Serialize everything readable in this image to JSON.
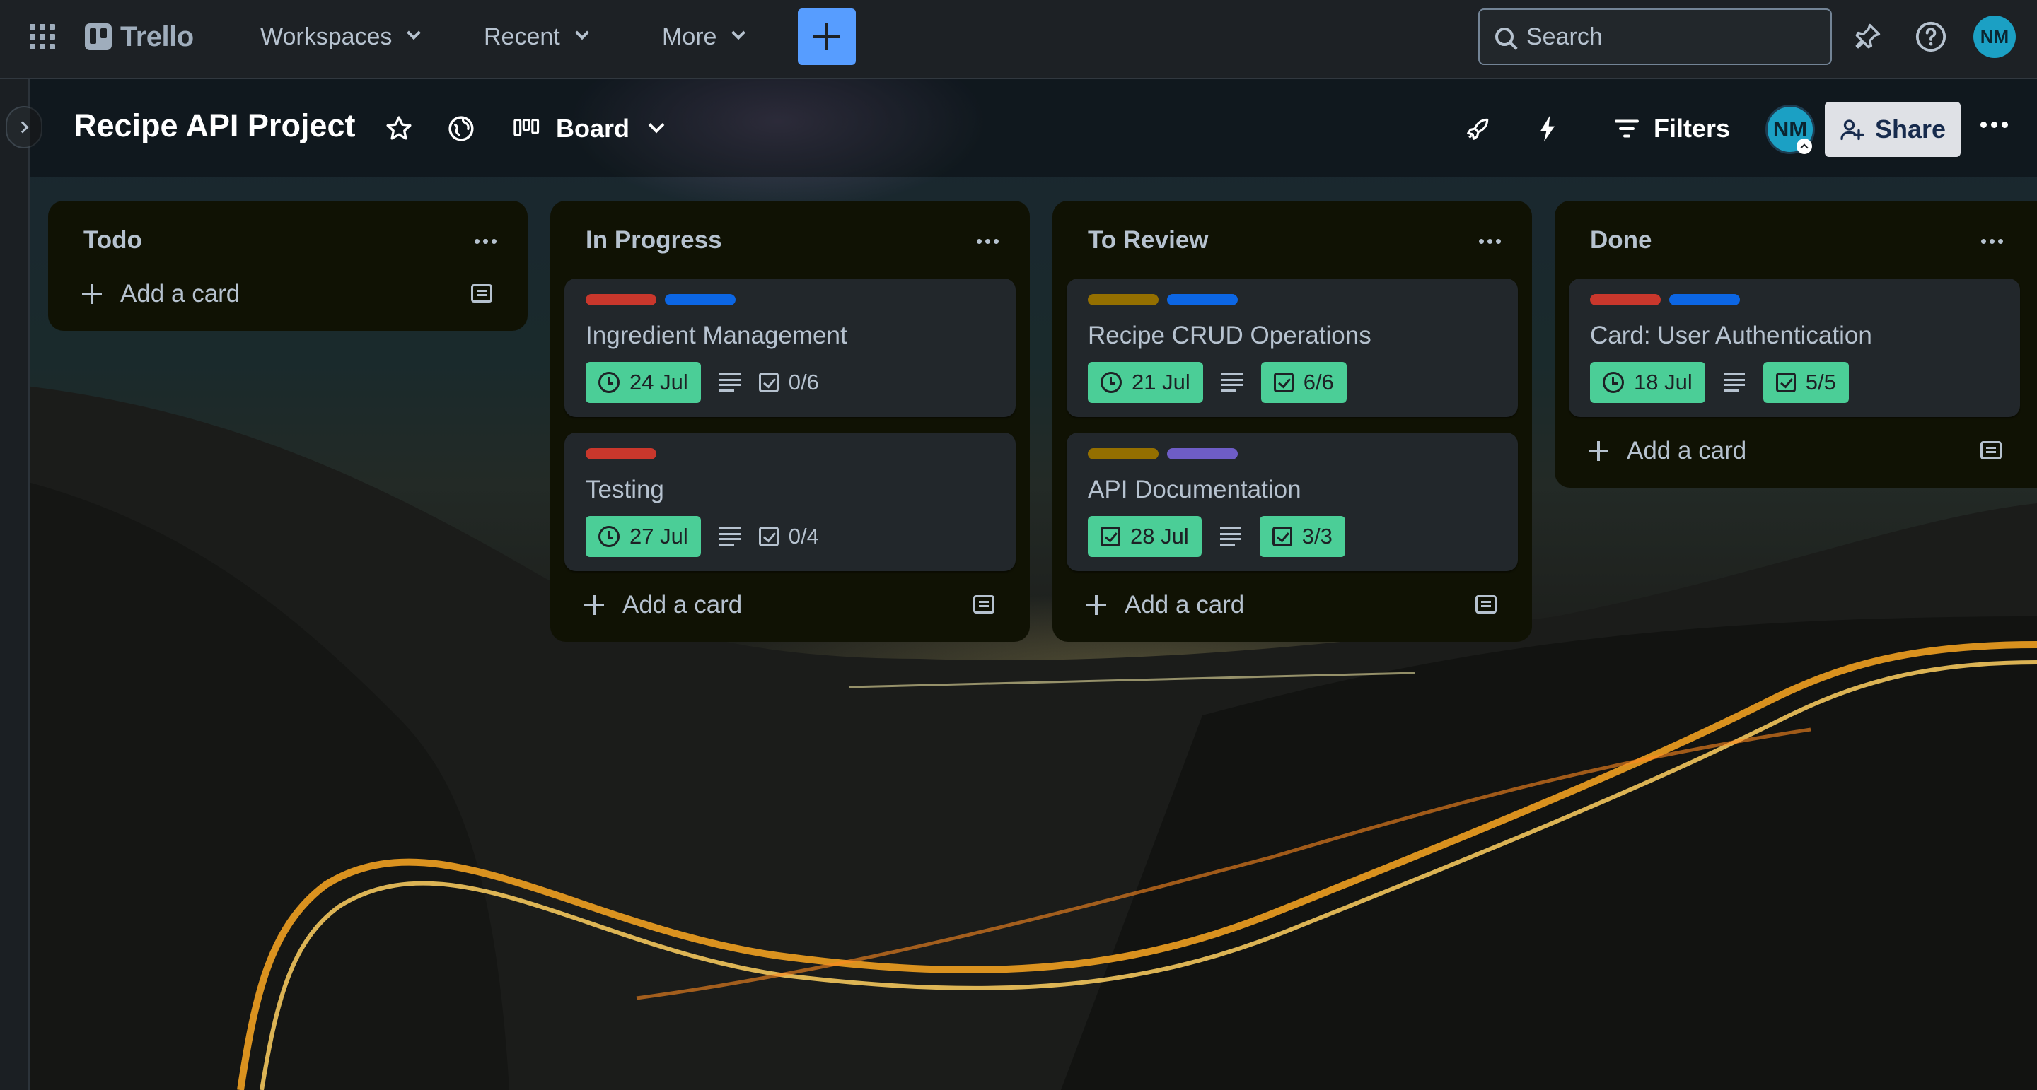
{
  "nav": {
    "app_name": "Trello",
    "menus": [
      {
        "label": "Workspaces"
      },
      {
        "label": "Recent"
      },
      {
        "label": "More"
      }
    ],
    "search_placeholder": "Search",
    "user_initials": "NM"
  },
  "board": {
    "title": "Recipe API Project",
    "view_label": "Board",
    "filters_label": "Filters",
    "member_initials": "NM",
    "share_label": "Share"
  },
  "colors": {
    "red": "#c9372c",
    "blue": "#0c66e4",
    "yellow": "#946f00",
    "purple": "#6e5dc6",
    "green_badge": "#4bce97"
  },
  "lists": [
    {
      "title": "Todo",
      "add_card_label": "Add a card",
      "cards": []
    },
    {
      "title": "In Progress",
      "add_card_label": "Add a card",
      "cards": [
        {
          "title": "Ingredient Management",
          "labels": [
            "red",
            "blue"
          ],
          "date": "24 Jul",
          "checklist": "0/6",
          "checklist_complete": false
        },
        {
          "title": "Testing",
          "labels": [
            "red"
          ],
          "date": "27 Jul",
          "checklist": "0/4",
          "checklist_complete": false
        }
      ]
    },
    {
      "title": "To Review",
      "add_card_label": "Add a card",
      "cards": [
        {
          "title": "Recipe CRUD Operations",
          "labels": [
            "yellow",
            "blue"
          ],
          "date": "21 Jul",
          "checklist": "6/6",
          "checklist_complete": true
        },
        {
          "title": "API Documentation",
          "labels": [
            "yellow",
            "purple"
          ],
          "date": "28 Jul",
          "checklist": "3/3",
          "checklist_complete": true,
          "date_completed": true
        }
      ]
    },
    {
      "title": "Done",
      "add_card_label": "Add a card",
      "cards": [
        {
          "title": "Card: User Authentication",
          "labels": [
            "red",
            "blue"
          ],
          "date": "18 Jul",
          "checklist": "5/5",
          "checklist_complete": true
        }
      ]
    }
  ]
}
